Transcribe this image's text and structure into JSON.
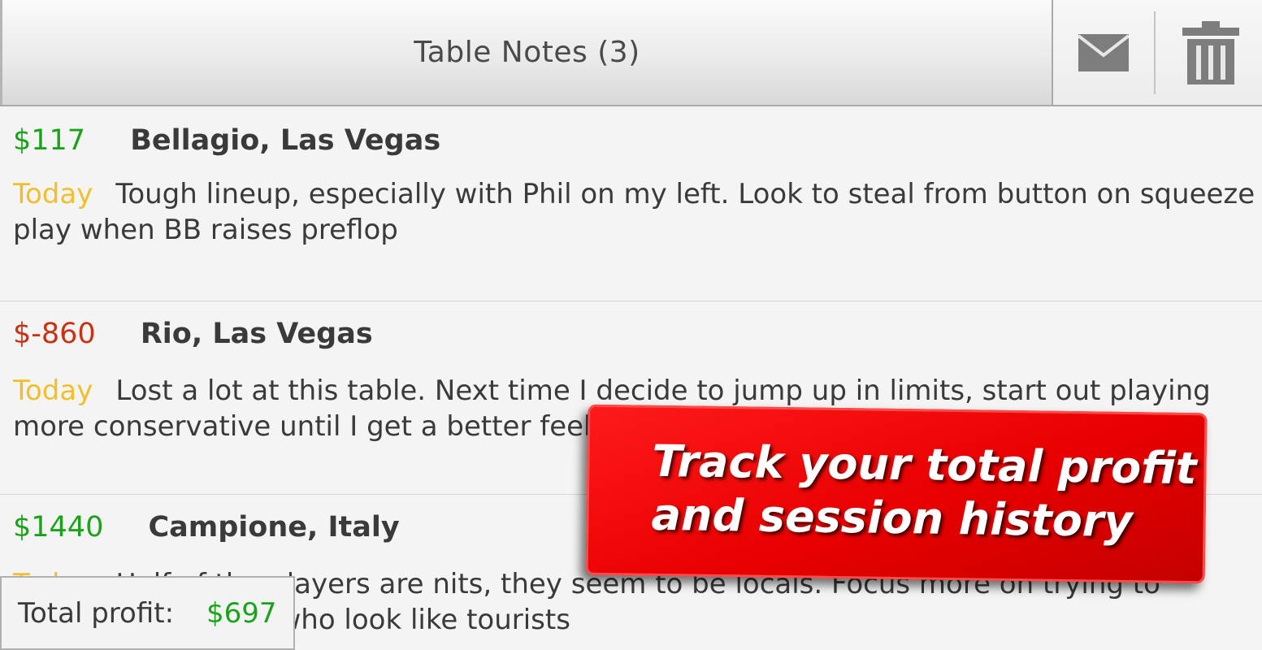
{
  "header": {
    "title": "Table Notes (3)",
    "mail_icon": "mail-icon",
    "trash_icon": "trash-icon"
  },
  "notes": [
    {
      "amount": "$117",
      "amount_status": "positive",
      "location": "Bellagio, Las Vegas",
      "date": "Today",
      "text": "Tough lineup, especially with Phil on my left. Look to steal from button on squeeze play when BB raises preflop"
    },
    {
      "amount": "$-860",
      "amount_status": "negative",
      "location": "Rio, Las Vegas",
      "date": "Today",
      "text": "Lost a lot at this table. Next time I decide to jump up in limits, start out playing more conservative until I get a better feel."
    },
    {
      "amount": "$1440",
      "amount_status": "positive",
      "location": "Campione, Italy",
      "date": "Today",
      "text": "Half of the players are nits, they seem to be locals. Focus more on trying to extract from those who look like tourists"
    }
  ],
  "footer": {
    "total_label": "Total profit:",
    "total_value": "$697"
  },
  "promo": {
    "line1": "Track your total profit",
    "line2": "and session history"
  },
  "colors": {
    "positive": "#1aa31a",
    "negative": "#c83214",
    "date": "#f2bf2c",
    "promo_bg": "#e80000"
  }
}
